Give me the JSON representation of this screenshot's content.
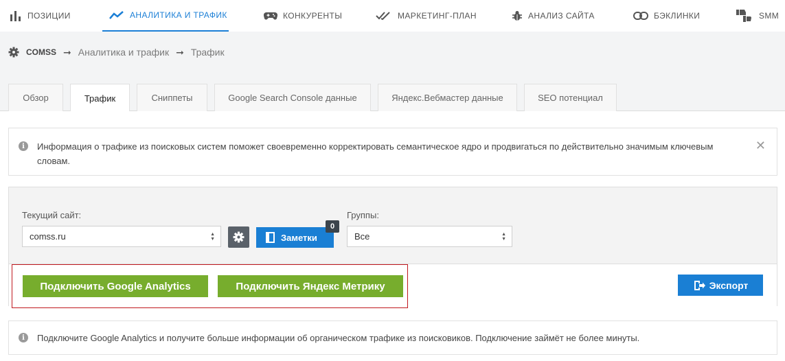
{
  "nav": {
    "items": [
      {
        "label": "ПОЗИЦИИ",
        "icon": "bar-chart-icon"
      },
      {
        "label": "АНАЛИТИКА И ТРАФИК",
        "icon": "trend-line-icon",
        "active": true
      },
      {
        "label": "КОНКУРЕНТЫ",
        "icon": "gamepad-icon"
      },
      {
        "label": "МАРКЕТИНГ-ПЛАН",
        "icon": "double-check-icon"
      },
      {
        "label": "АНАЛИЗ САЙТА",
        "icon": "bug-icon"
      },
      {
        "label": "БЭКЛИНКИ",
        "icon": "link-icon"
      },
      {
        "label": "SMM",
        "icon": "thumbs-icon"
      }
    ]
  },
  "breadcrumb": {
    "site": "COMSS",
    "items": [
      "Аналитика и трафик",
      "Трафик"
    ],
    "separator": "➞"
  },
  "tabs": [
    {
      "label": "Обзор"
    },
    {
      "label": "Трафик",
      "active": true
    },
    {
      "label": "Сниппеты"
    },
    {
      "label": "Google Search Console данные"
    },
    {
      "label": "Яндекс.Вебмастер данные"
    },
    {
      "label": "SEO потенциал"
    }
  ],
  "info_top": {
    "text": "Информация о трафике из поисковых систем поможет своевременно корректировать семантическое ядро и продвигаться по действительно значимым ключевым словам."
  },
  "controls": {
    "site_label": "Текущий сайт:",
    "site_value": "comss.ru",
    "notes_label": "Заметки",
    "notes_count": "0",
    "groups_label": "Группы:",
    "groups_value": "Все"
  },
  "actions": {
    "connect_ga": "Подключить Google Analytics",
    "connect_ym": "Подключить Яндекс Метрику",
    "export": "Экспорт"
  },
  "info_bottom": {
    "text": "Подключите Google Analytics и получите больше информации об органическом трафике из поисковиков. Подключение займёт не более минуты."
  },
  "colors": {
    "accent_blue": "#1a7fd4",
    "green": "#77ad2d",
    "highlight_red": "#c0181e",
    "dark_button": "#5a6169"
  }
}
